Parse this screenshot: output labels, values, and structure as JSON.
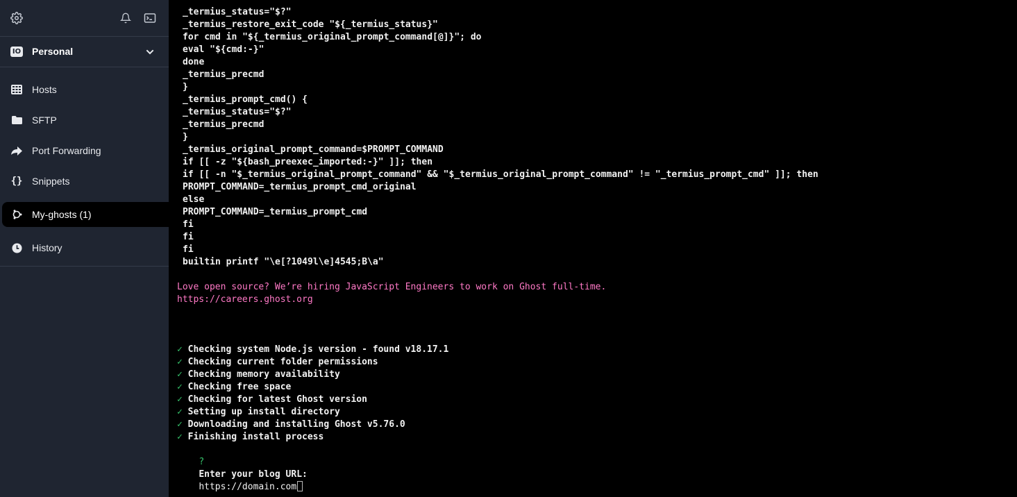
{
  "sidebar": {
    "top_icons": [
      "gear-icon",
      "bell-icon",
      "terminal-icon"
    ],
    "vault": {
      "badge": "IO",
      "label": "Personal"
    },
    "items": [
      {
        "label": "Hosts",
        "icon": "hosts-grid-icon"
      },
      {
        "label": "SFTP",
        "icon": "folder-icon"
      },
      {
        "label": "Port Forwarding",
        "icon": "forward-arrow-icon"
      },
      {
        "label": "Snippets",
        "icon": "braces-icon"
      },
      {
        "label": "My-ghosts (1)",
        "icon": "linux-ubuntu-icon",
        "active": true
      },
      {
        "label": "History",
        "icon": "clock-icon"
      }
    ]
  },
  "terminal": {
    "code_lines": [
      "_termius_status=\"$?\"",
      "_termius_restore_exit_code \"${_termius_status}\"",
      "for cmd in \"${_termius_original_prompt_command[@]}\"; do",
      "eval \"${cmd:-}\"",
      "done",
      "_termius_precmd",
      "}",
      "_termius_prompt_cmd() {",
      "_termius_status=\"$?\"",
      "_termius_precmd",
      "}",
      "_termius_original_prompt_command=$PROMPT_COMMAND",
      "if [[ -z \"${bash_preexec_imported:-}\" ]]; then",
      "if [[ -n \"$_termius_original_prompt_command\" && \"$_termius_original_prompt_command\" != \"_termius_prompt_cmd\" ]]; then",
      "PROMPT_COMMAND=_termius_prompt_cmd_original",
      "else",
      "PROMPT_COMMAND=_termius_prompt_cmd",
      "fi",
      "fi",
      "fi",
      "builtin printf \"\\e[?1049l\\e]4545;B\\a\""
    ],
    "ghost_banner": [
      "Love open source? We’re hiring JavaScript Engineers to work on Ghost full-time.",
      "https://careers.ghost.org"
    ],
    "check_mark": "✓",
    "checks": [
      "Checking system Node.js version - found v18.17.1",
      "Checking current folder permissions",
      "Checking memory availability",
      "Checking free space",
      "Checking for latest Ghost version",
      "Setting up install directory",
      "Downloading and installing Ghost v5.76.0",
      "Finishing install process"
    ],
    "prompt": {
      "marker": "?",
      "question": "Enter your blog URL:",
      "answer": "https://domain.com"
    },
    "colors": {
      "banner": "#ff79c6",
      "check": "#36c26b",
      "sidebar_bg": "#1f2531"
    }
  }
}
